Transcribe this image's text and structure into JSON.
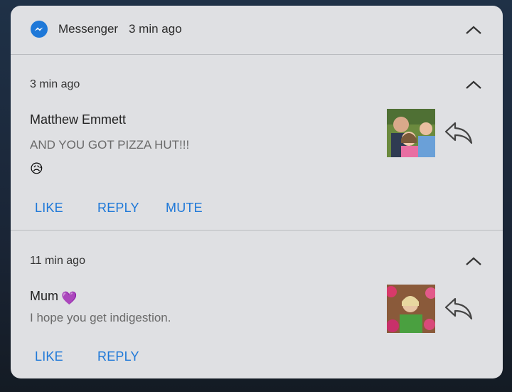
{
  "header": {
    "app_name": "Messenger",
    "time": "3 min ago",
    "brand_color": "#1e78d8"
  },
  "notifications": [
    {
      "time": "3 min ago",
      "sender": "Matthew Emmett",
      "message": "AND YOU GOT PIZZA HUT!!!",
      "emoji": "😥",
      "avatar_icon": "family-photo",
      "actions": [
        "LIKE",
        "REPLY",
        "MUTE"
      ]
    },
    {
      "time": "11 min ago",
      "sender": "Mum",
      "sender_emoji": "💜",
      "message": "I hope you get indigestion.",
      "avatar_icon": "woman-photo",
      "actions": [
        "LIKE",
        "REPLY"
      ]
    }
  ],
  "icons": {
    "collapse": "chevron-up-icon",
    "reply": "reply-arrow-icon",
    "app": "messenger-icon"
  }
}
